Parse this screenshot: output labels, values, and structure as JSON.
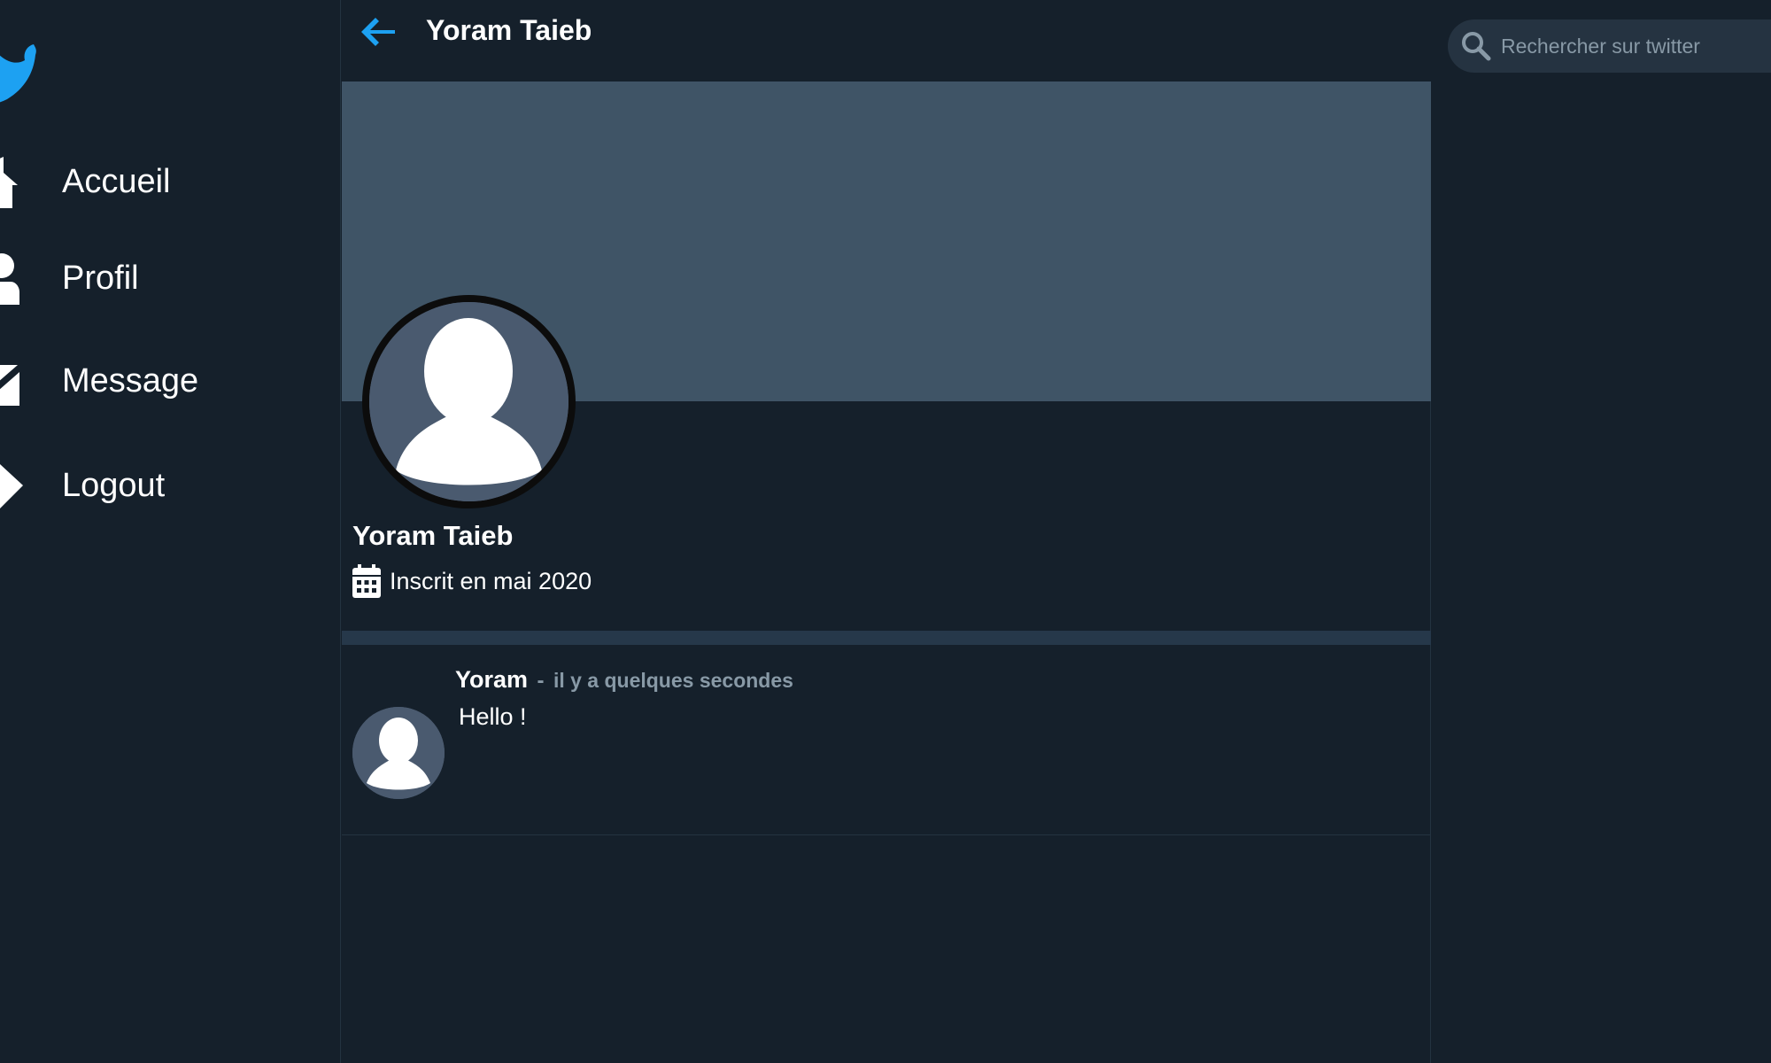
{
  "colors": {
    "background": "#15202b",
    "banner": "#3f5466",
    "accent": "#1da1f2",
    "muted_text": "#8899a6",
    "separator": "#26384a",
    "search_bg": "#253341"
  },
  "sidebar": {
    "logo_icon": "twitter-bird-icon",
    "items": [
      {
        "label": "Accueil",
        "icon": "home-icon"
      },
      {
        "label": "Profil",
        "icon": "user-icon"
      },
      {
        "label": "Message",
        "icon": "envelope-icon"
      },
      {
        "label": "Logout",
        "icon": "logout-icon"
      }
    ]
  },
  "header": {
    "back_icon": "arrow-left-icon",
    "title": "Yoram Taieb"
  },
  "profile": {
    "name": "Yoram Taieb",
    "joined": "Inscrit en mai 2020",
    "joined_icon": "calendar-icon",
    "avatar_icon": "default-avatar-icon"
  },
  "tweets": [
    {
      "author": "Yoram",
      "separator": "-",
      "time": "il y a quelques secondes",
      "text": "Hello !"
    }
  ],
  "search": {
    "placeholder": "Rechercher sur twitter",
    "value": "",
    "icon": "search-icon"
  }
}
